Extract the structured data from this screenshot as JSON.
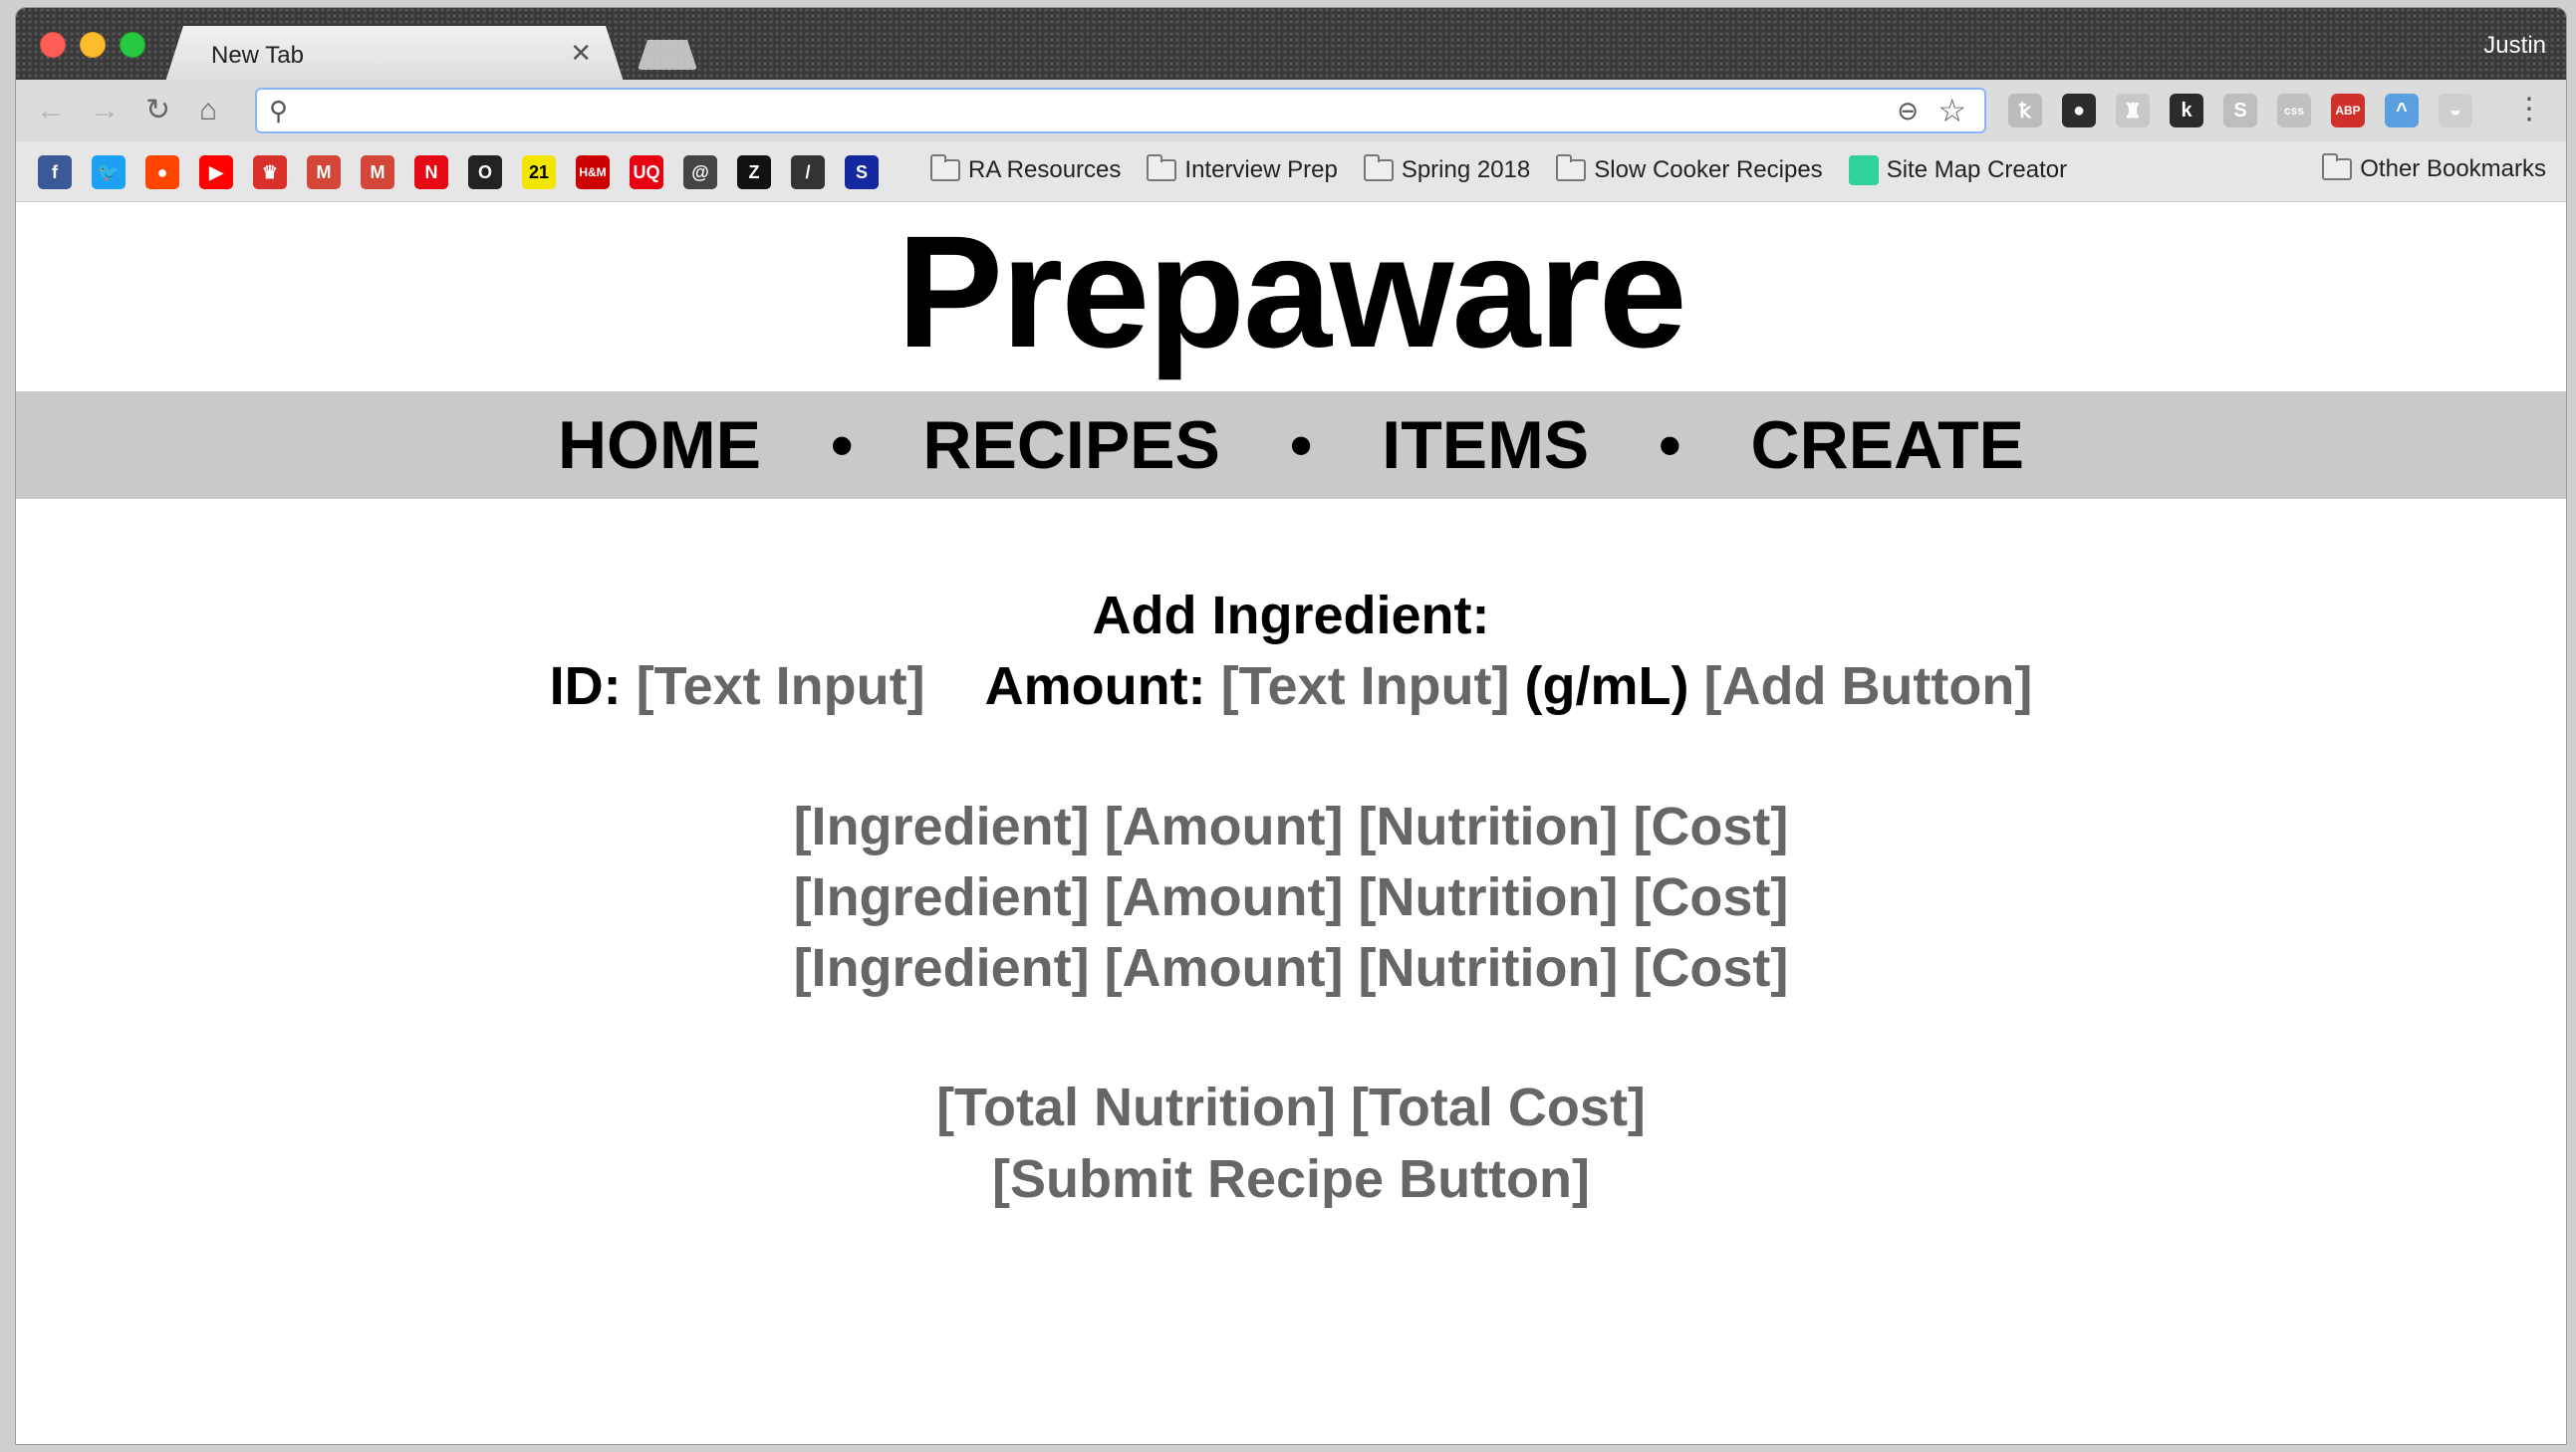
{
  "browser": {
    "tab_title": "New Tab",
    "profile_name": "Justin",
    "omnibox_value": "",
    "bookmark_icons": [
      {
        "name": "facebook-icon",
        "glyph": "f",
        "color": "#3b5998"
      },
      {
        "name": "twitter-icon",
        "glyph": "🐦",
        "color": "#1da1f2"
      },
      {
        "name": "reddit-icon",
        "glyph": "●",
        "color": "#ff4500"
      },
      {
        "name": "youtube-icon",
        "glyph": "▶",
        "color": "#ff0000"
      },
      {
        "name": "crown-icon",
        "glyph": "♛",
        "color": "#d9302c"
      },
      {
        "name": "gmail-icon",
        "glyph": "M",
        "color": "#d44638"
      },
      {
        "name": "gmail-alt-icon",
        "glyph": "M",
        "color": "#d44638"
      },
      {
        "name": "netflix-icon",
        "glyph": "N",
        "color": "#e50914"
      },
      {
        "name": "circle-icon",
        "glyph": "O",
        "color": "#222222"
      },
      {
        "name": "twentyone-icon",
        "glyph": "21",
        "color": "#f2e500"
      },
      {
        "name": "hm-icon",
        "glyph": "H&M",
        "color": "#cc0000"
      },
      {
        "name": "uniqlo-icon",
        "glyph": "UQ",
        "color": "#e60012"
      },
      {
        "name": "at-icon",
        "glyph": "@",
        "color": "#444444"
      },
      {
        "name": "zara-icon",
        "glyph": "Z",
        "color": "#111111"
      },
      {
        "name": "slash-icon",
        "glyph": "/",
        "color": "#333333"
      },
      {
        "name": "samsung-icon",
        "glyph": "S",
        "color": "#1428a0"
      }
    ],
    "bookmark_folders": [
      "RA Resources",
      "Interview Prep",
      "Spring 2018",
      "Slow Cooker Recipes"
    ],
    "site_map_label": "Site Map Creator",
    "other_bookmarks": "Other Bookmarks",
    "extensions": [
      {
        "name": "feather-ext-icon",
        "glyph": "ꝁ",
        "color": "#bbbbbb"
      },
      {
        "name": "green-dot-ext-icon",
        "glyph": "●",
        "color": "#2c2c2c"
      },
      {
        "name": "cup-ext-icon",
        "glyph": "♜",
        "color": "#c8c8c8"
      },
      {
        "name": "k-ext-icon",
        "glyph": "k",
        "color": "#2b2b2b"
      },
      {
        "name": "s-ext-icon",
        "glyph": "S",
        "color": "#bdbdbd"
      },
      {
        "name": "css-ext-icon",
        "glyph": "css",
        "color": "#c0c0c0"
      },
      {
        "name": "abp-ext-icon",
        "glyph": "ABP",
        "color": "#d0302a"
      },
      {
        "name": "rainbow-ext-icon",
        "glyph": "^",
        "color": "#5aa0e0"
      },
      {
        "name": "pot-ext-icon",
        "glyph": "◒",
        "color": "#cfcfcf"
      }
    ]
  },
  "site": {
    "title": "Prepaware",
    "nav": [
      "HOME",
      "RECIPES",
      "ITEMS",
      "CREATE"
    ],
    "nav_separator": "•"
  },
  "form": {
    "heading": "Add Ingredient:",
    "id_label": "ID:",
    "id_placeholder": "[Text Input]",
    "amount_label": "Amount:",
    "amount_placeholder": "[Text Input]",
    "unit": "(g/mL)",
    "add_button": "[Add Button]"
  },
  "ingredients": [
    {
      "ingredient": "[Ingredient]",
      "amount": "[Amount]",
      "nutrition": "[Nutrition]",
      "cost": "[Cost]"
    },
    {
      "ingredient": "[Ingredient]",
      "amount": "[Amount]",
      "nutrition": "[Nutrition]",
      "cost": "[Cost]"
    },
    {
      "ingredient": "[Ingredient]",
      "amount": "[Amount]",
      "nutrition": "[Nutrition]",
      "cost": "[Cost]"
    }
  ],
  "totals": {
    "nutrition": "[Total Nutrition]",
    "cost": "[Total Cost]",
    "submit": "[Submit Recipe Button]"
  }
}
